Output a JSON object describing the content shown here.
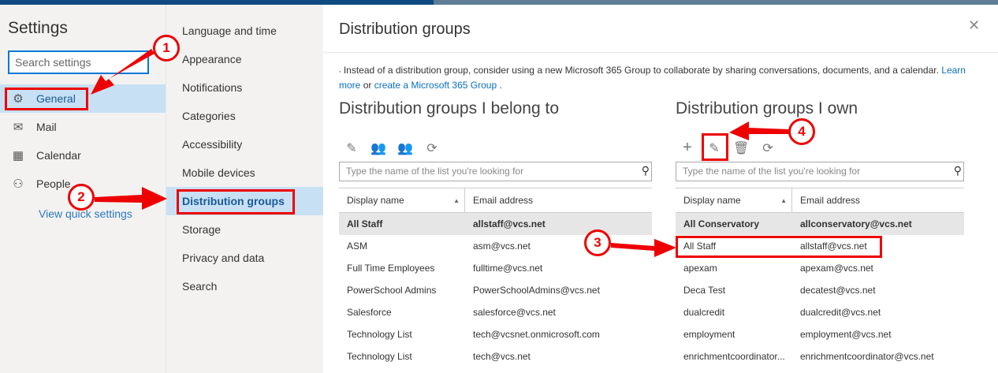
{
  "settings": {
    "title": "Settings",
    "search_placeholder": "Search settings",
    "nav": [
      {
        "label": "General",
        "icon": "gear-icon"
      },
      {
        "label": "Mail",
        "icon": "mail-icon"
      },
      {
        "label": "Calendar",
        "icon": "calendar-icon"
      },
      {
        "label": "People",
        "icon": "people-icon"
      }
    ],
    "quick": "View quick settings"
  },
  "general_nav": [
    "Language and time",
    "Appearance",
    "Notifications",
    "Categories",
    "Accessibility",
    "Mobile devices",
    "Distribution groups",
    "Storage",
    "Privacy and data",
    "Search"
  ],
  "main": {
    "title": "Distribution groups",
    "info": "Instead of a distribution group, consider using a new Microsoft 365 Group to collaborate by sharing conversations, documents, and a calendar.",
    "learn": "Learn more",
    "or": "or",
    "create": "create a Microsoft 365 Group",
    "period": ".",
    "belong": {
      "title": "Distribution groups I belong to",
      "search_placeholder": "Type the name of the list you're looking for",
      "col_name": "Display name",
      "col_email": "Email address",
      "rows": [
        [
          "All Staff",
          "allstaff@vcs.net"
        ],
        [
          "ASM",
          "asm@vcs.net"
        ],
        [
          "Full Time Employees",
          "fulltime@vcs.net"
        ],
        [
          "PowerSchool Admins",
          "PowerSchoolAdmins@vcs.net"
        ],
        [
          "Salesforce",
          "salesforce@vcs.net"
        ],
        [
          "Technology List",
          "tech@vcsnet.onmicrosoft.com"
        ],
        [
          "Technology List",
          "tech@vcs.net"
        ]
      ]
    },
    "own": {
      "title": "Distribution groups I own",
      "search_placeholder": "Type the name of the list you're looking for",
      "col_name": "Display name",
      "col_email": "Email address",
      "rows": [
        [
          "All Conservatory",
          "allconservatory@vcs.net"
        ],
        [
          "All Staff",
          "allstaff@vcs.net"
        ],
        [
          "apexam",
          "apexam@vcs.net"
        ],
        [
          "Deca Test",
          "decatest@vcs.net"
        ],
        [
          "dualcredit",
          "dualcredit@vcs.net"
        ],
        [
          "employment",
          "employment@vcs.net"
        ],
        [
          "enrichmentcoordinator...",
          "enrichmentcoordinator@vcs.net"
        ]
      ]
    }
  },
  "annotations": [
    "1",
    "2",
    "3",
    "4"
  ],
  "colors": {
    "accent": "#0078d4",
    "selected": "#c7e0f4",
    "annotation": "#ee0000"
  }
}
